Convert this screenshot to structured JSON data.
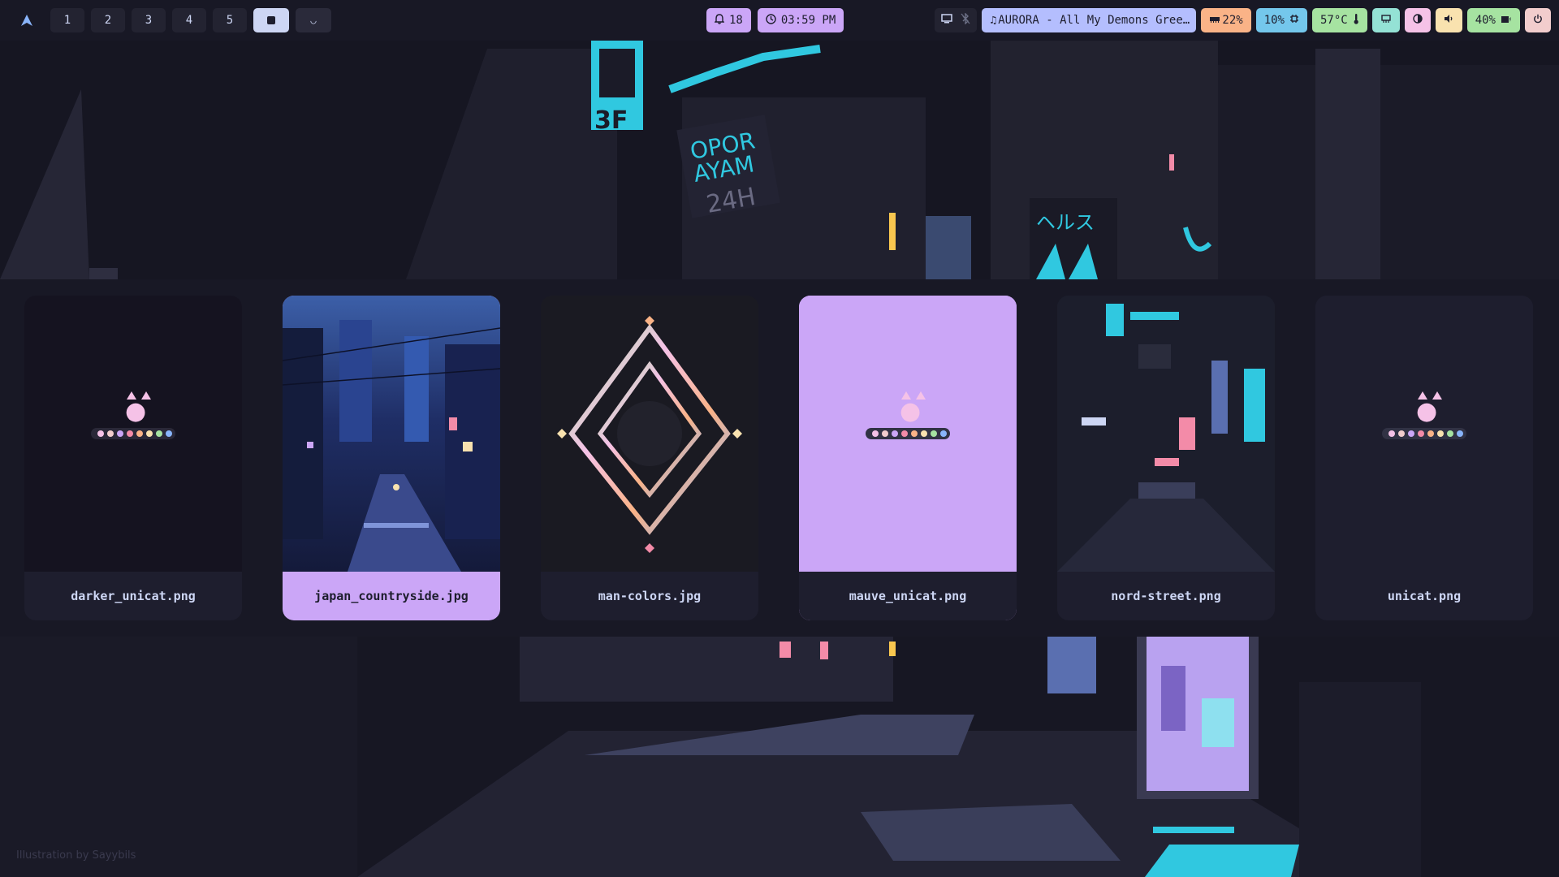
{
  "topbar": {
    "logo_icon": "arch-icon",
    "workspaces": [
      "1",
      "2",
      "3",
      "4",
      "5"
    ],
    "active_workspace_icon": "square-icon",
    "special_workspace_icon": "cat-icon",
    "notifications": {
      "icon": "bell-icon",
      "count": "18"
    },
    "clock": {
      "icon": "clock-icon",
      "time": "03:59 PM"
    },
    "tray": {
      "screen_icon": "monitor-icon",
      "bluetooth_icon": "bluetooth-off-icon"
    },
    "media": {
      "icon": "music-note-icon",
      "text": "AURORA - All My Demons Gree…"
    },
    "memory": {
      "icon": "memory-icon",
      "text": "22%"
    },
    "cpu": {
      "icon": "cpu-icon",
      "text": "10%"
    },
    "temperature": {
      "icon": "thermometer-icon",
      "text": "57°C"
    },
    "network": {
      "icon": "ethernet-icon"
    },
    "brightness": {
      "icon": "brightness-icon"
    },
    "volume": {
      "icon": "speaker-icon"
    },
    "battery": {
      "icon": "battery-charging-icon",
      "text": "40%"
    },
    "power": {
      "icon": "power-icon"
    }
  },
  "wallpaper_picker": {
    "selected_index": 3,
    "items": [
      {
        "filename": "darker_unicat.png",
        "thumb": "unicat-dark"
      },
      {
        "filename": "japan_countryside.jpg",
        "thumb": "city-rain"
      },
      {
        "filename": "man-colors.jpg",
        "thumb": "diamond"
      },
      {
        "filename": "mauve_unicat.png",
        "thumb": "unicat-mauve"
      },
      {
        "filename": "nord-street.png",
        "thumb": "neon-street"
      },
      {
        "filename": "unicat.png",
        "thumb": "unicat"
      }
    ]
  },
  "wallpaper": {
    "signs": [
      "OPOR",
      "AYAM",
      "24H",
      "3F",
      "ヘルス"
    ],
    "credit": "Illustration by Sayybils"
  },
  "colors": {
    "mauve": "#cba6f7",
    "peach": "#fab387",
    "sapphire": "#74c7ec",
    "green": "#a6e3a1",
    "teal": "#94e2d5",
    "pink": "#f5c2e7",
    "yellow": "#f9e2af",
    "flamingo": "#f2cdcd",
    "base": "#1e1e2e",
    "mantle": "#181825",
    "text": "#cdd6f4"
  }
}
